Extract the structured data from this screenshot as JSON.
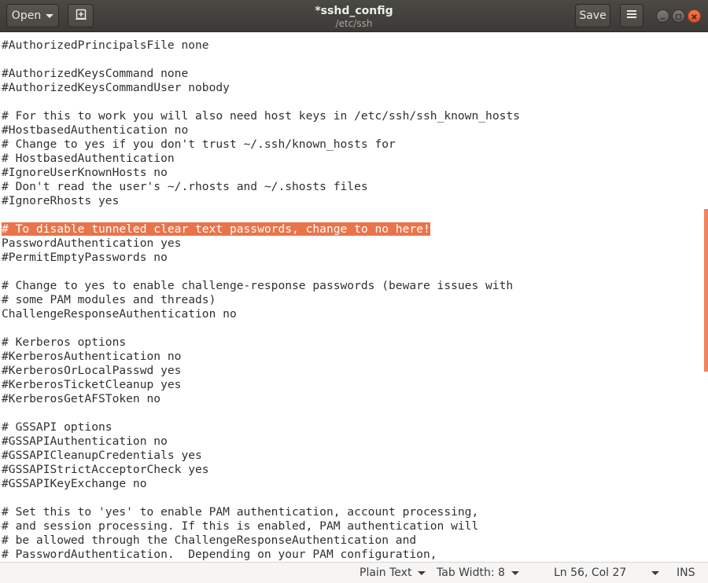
{
  "window": {
    "title": "*sshd_config",
    "subtitle": "/etc/ssh"
  },
  "toolbar": {
    "open_label": "Open",
    "save_label": "Save"
  },
  "icons": {
    "new_tab": "new-tab-icon",
    "menu": "hamburger-menu-icon",
    "minimize": "minimize-icon",
    "maximize": "maximize-icon",
    "close": "close-icon"
  },
  "colors": {
    "selection": "#e9744a",
    "close_button": "#e0542a",
    "scroll_indicator": "#ef8460"
  },
  "editor": {
    "selected_line_index": 13,
    "lines": [
      "#AuthorizedPrincipalsFile none",
      "",
      "#AuthorizedKeysCommand none",
      "#AuthorizedKeysCommandUser nobody",
      "",
      "# For this to work you will also need host keys in /etc/ssh/ssh_known_hosts",
      "#HostbasedAuthentication no",
      "# Change to yes if you don't trust ~/.ssh/known_hosts for",
      "# HostbasedAuthentication",
      "#IgnoreUserKnownHosts no",
      "# Don't read the user's ~/.rhosts and ~/.shosts files",
      "#IgnoreRhosts yes",
      "",
      "# To disable tunneled clear text passwords, change to no here!",
      "PasswordAuthentication yes",
      "#PermitEmptyPasswords no",
      "",
      "# Change to yes to enable challenge-response passwords (beware issues with",
      "# some PAM modules and threads)",
      "ChallengeResponseAuthentication no",
      "",
      "# Kerberos options",
      "#KerberosAuthentication no",
      "#KerberosOrLocalPasswd yes",
      "#KerberosTicketCleanup yes",
      "#KerberosGetAFSToken no",
      "",
      "# GSSAPI options",
      "#GSSAPIAuthentication no",
      "#GSSAPICleanupCredentials yes",
      "#GSSAPIStrictAcceptorCheck yes",
      "#GSSAPIKeyExchange no",
      "",
      "# Set this to 'yes' to enable PAM authentication, account processing,",
      "# and session processing. If this is enabled, PAM authentication will",
      "# be allowed through the ChallengeResponseAuthentication and",
      "# PasswordAuthentication.  Depending on your PAM configuration,"
    ]
  },
  "statusbar": {
    "language": "Plain Text",
    "tab_width": "Tab Width: 8",
    "position": "Ln 56, Col 27",
    "mode": "INS"
  }
}
